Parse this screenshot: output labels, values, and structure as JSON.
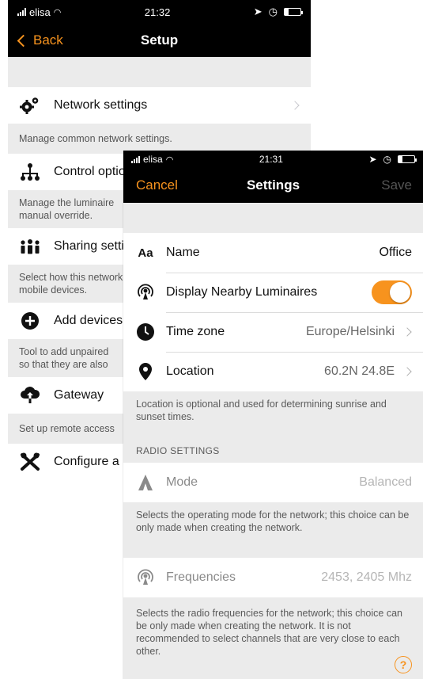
{
  "back": {
    "status": {
      "carrier": "elisa",
      "time": "21:32"
    },
    "nav": {
      "back_label": "Back",
      "title": "Setup"
    },
    "items": [
      {
        "label": "Network settings",
        "desc": "Manage common network settings.",
        "icon": "gears-icon"
      },
      {
        "label": "Control options",
        "desc": "Manage the luminaire\nmanual override.",
        "icon": "hierarchy-icon"
      },
      {
        "label": "Sharing settings",
        "desc": "Select how this network\nmobile devices.",
        "icon": "people-icon"
      },
      {
        "label": "Add devices",
        "desc": "Tool to add unpaired\nso that they are also",
        "icon": "plus-circle-icon"
      },
      {
        "label": "Gateway",
        "desc": "Set up remote access",
        "icon": "cloud-upload-icon"
      },
      {
        "label": "Configure a",
        "desc": "",
        "icon": "tools-icon"
      }
    ]
  },
  "front": {
    "status": {
      "carrier": "elisa",
      "time": "21:31"
    },
    "nav": {
      "cancel_label": "Cancel",
      "title": "Settings",
      "save_label": "Save"
    },
    "rows": {
      "name": {
        "icon_text": "Aa",
        "label": "Name",
        "value": "Office"
      },
      "nearby": {
        "label": "Display Nearby Luminaires",
        "toggle_on": true
      },
      "timezone": {
        "label": "Time zone",
        "value": "Europe/Helsinki"
      },
      "location": {
        "label": "Location",
        "value": "60.2N 24.8E"
      }
    },
    "location_desc": "Location is optional and used for determining sunrise and sunset times.",
    "radio_header": "RADIO SETTINGS",
    "mode": {
      "label": "Mode",
      "value": "Balanced"
    },
    "mode_desc": "Selects the operating mode for the network; this choice can be only made when creating the network.",
    "frequencies": {
      "label": "Frequencies",
      "value": "2453, 2405 Mhz"
    },
    "freq_desc": "Selects the radio frequencies for the network; this choice can be only made when creating the network. It is not recommended to select channels that are very close to each other.",
    "help_label": "?"
  },
  "colors": {
    "accent": "#f7931e",
    "background": "#ebebeb",
    "bar": "#000000"
  }
}
